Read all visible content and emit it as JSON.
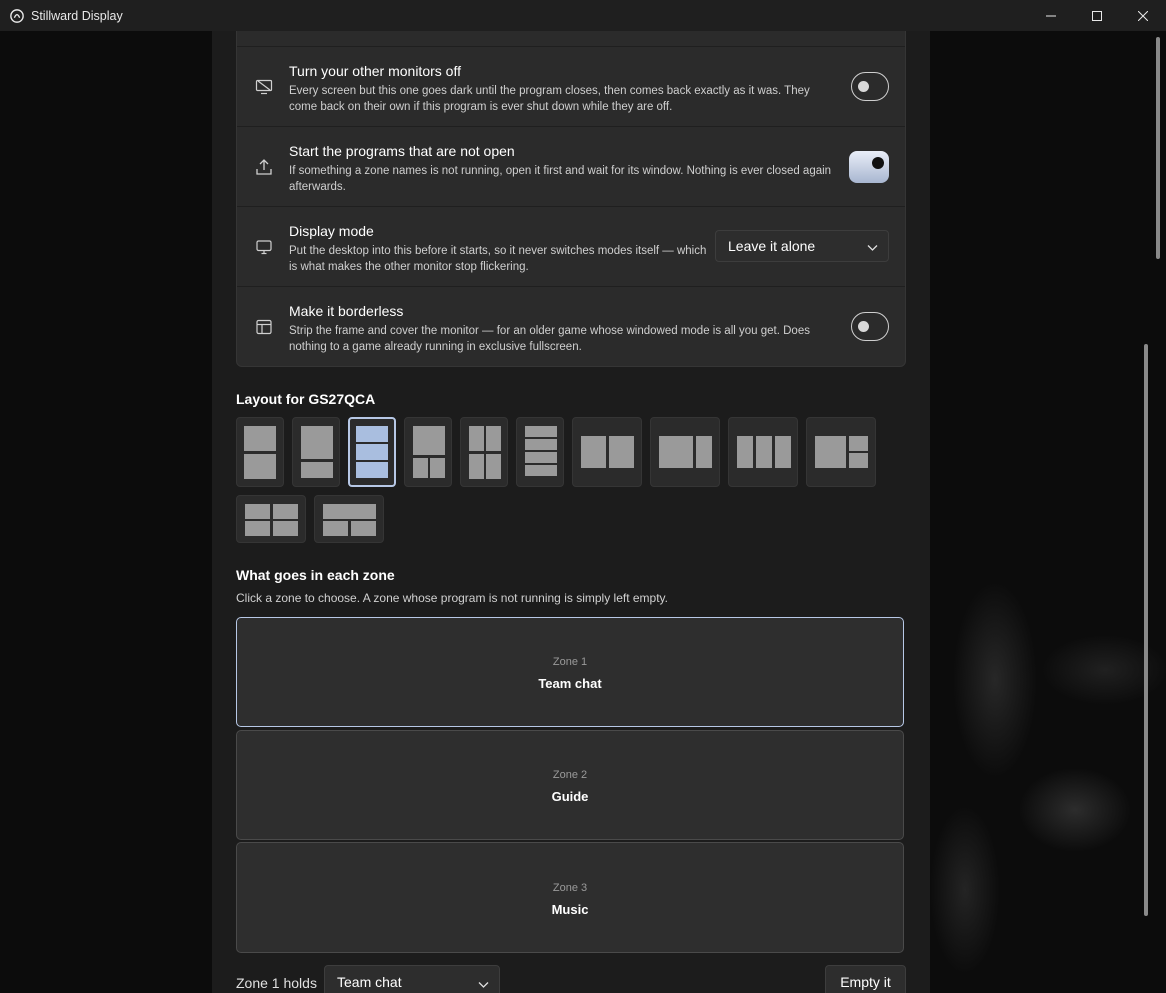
{
  "window": {
    "title": "Stillward Display",
    "app_icon": "app-logo-icon",
    "controls": [
      "minimize-icon",
      "maximize-icon",
      "close-icon"
    ]
  },
  "settings": [
    {
      "icon": "monitor-off-icon",
      "title": "Turn your other monitors off",
      "description": "Every screen but this one goes dark until the program closes, then comes back exactly as it was. They come back on their own if this program is ever shut down while they are off.",
      "control": "toggle",
      "on": false
    },
    {
      "icon": "upload-icon",
      "title": "Start the programs that are not open",
      "description": "If something a zone names is not running, open it first and wait for its window. Nothing is ever closed again afterwards.",
      "control": "toggle",
      "on": true
    },
    {
      "icon": "display-icon",
      "title": "Display mode",
      "description": "Put the desktop into this before it starts, so it never switches modes itself — which is what makes the other monitor stop flickering.",
      "control": "dropdown",
      "value": "Leave it alone"
    },
    {
      "icon": "layout-icon",
      "title": "Make it borderless",
      "description": "Strip the frame and cover the monitor — for an older game whose windowed mode is all you get. Does nothing to a game already running in exclusive fullscreen.",
      "control": "toggle",
      "on": false
    }
  ],
  "layout_section": {
    "title": "Layout for GS27QCA",
    "selected_index": 2
  },
  "zones_section": {
    "title": "What goes in each zone",
    "subtitle": "Click a zone to choose. A zone whose program is not running is simply left empty.",
    "zones": [
      {
        "label": "Zone 1",
        "name": "Team chat",
        "selected": true
      },
      {
        "label": "Zone 2",
        "name": "Guide",
        "selected": false
      },
      {
        "label": "Zone 3",
        "name": "Music",
        "selected": false
      }
    ]
  },
  "footer": {
    "holds_label": "Zone 1 holds",
    "holds_value": "Team chat",
    "empty_button": "Empty it"
  },
  "colors": {
    "accent": "#b7c8e6",
    "background": "#1c1c1c",
    "card": "#2b2b2b"
  }
}
